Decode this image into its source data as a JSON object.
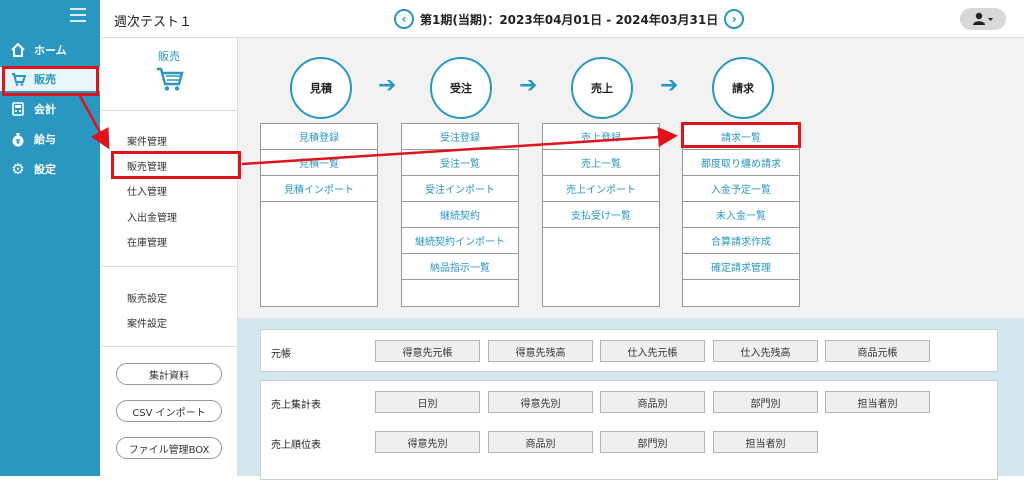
{
  "header": {
    "company": "週次テスト１",
    "period": "第1期(当期)：2023年04月01日 - 2024年03月31日",
    "prev_icon": "chevron-left-icon",
    "next_icon": "chevron-right-icon",
    "user_icon": "user-icon"
  },
  "leftnav": {
    "items": [
      {
        "label": "ホーム",
        "icon": "home-icon"
      },
      {
        "label": "販売",
        "icon": "cart-icon"
      },
      {
        "label": "会計",
        "icon": "calculator-icon"
      },
      {
        "label": "給与",
        "icon": "money-bag-icon"
      },
      {
        "label": "設定",
        "icon": "gear-icon"
      }
    ],
    "active_index": 1,
    "color": "#2a97c1"
  },
  "subside": {
    "title": "販売",
    "links_a": [
      "案件管理",
      "販売管理",
      "仕入管理",
      "入出金管理",
      "在庫管理"
    ],
    "links_b": [
      "販売設定",
      "案件設定"
    ],
    "buttons": [
      "集計資料",
      "CSV インポート",
      "ファイル管理BOX"
    ]
  },
  "flow": {
    "steps": [
      {
        "label": "見積",
        "links": [
          "見積登録",
          "見積一覧",
          "見積インポート"
        ]
      },
      {
        "label": "受注",
        "links": [
          "受注登録",
          "受注一覧",
          "受注インポート",
          "継続契約",
          "継続契約インポート",
          "納品指示一覧"
        ]
      },
      {
        "label": "売上",
        "links": [
          "売上登録",
          "売上一覧",
          "売上インポート",
          "支払受け一覧"
        ]
      },
      {
        "label": "請求",
        "links": [
          "請求一覧",
          "都度取り纏め請求",
          "入金予定一覧",
          "未入金一覧",
          "合算請求作成",
          "確定請求管理"
        ]
      }
    ],
    "arrow": "➔"
  },
  "reports": {
    "rows": [
      {
        "label": "元帳",
        "buttons": [
          "得意先元帳",
          "得意先残高",
          "仕入先元帳",
          "仕入先残高",
          "商品元帳"
        ]
      },
      {
        "label": "売上集計表",
        "buttons": [
          "日別",
          "得意先別",
          "商品別",
          "部門別",
          "担当者別"
        ]
      },
      {
        "label": "売上順位表",
        "buttons": [
          "得意先別",
          "商品別",
          "部門別",
          "担当者別"
        ]
      }
    ]
  },
  "colors": {
    "accent": "#2a97c1",
    "highlight": "#e0131d"
  }
}
